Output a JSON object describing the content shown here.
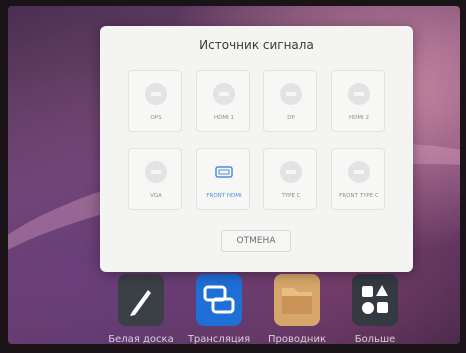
{
  "dialog": {
    "title": "Источник сигнала",
    "cancel_label": "ОТМЕНА",
    "sources": [
      {
        "label": "OPS",
        "icon": "ops-input-icon",
        "selected": false
      },
      {
        "label": "HDMI 1",
        "icon": "hdmi-input-icon",
        "selected": false
      },
      {
        "label": "DP",
        "icon": "displayport-input-icon",
        "selected": false
      },
      {
        "label": "HDMI 2",
        "icon": "hdmi-input-icon",
        "selected": false
      },
      {
        "label": "VGA",
        "icon": "vga-input-icon",
        "selected": false
      },
      {
        "label": "FRONT HDMI",
        "icon": "hdmi-input-icon",
        "selected": true
      },
      {
        "label": "TYPE C",
        "icon": "usb-c-input-icon",
        "selected": false
      },
      {
        "label": "FRONT TYPE C",
        "icon": "usb-c-input-icon",
        "selected": false
      }
    ],
    "accent_color": "#4a8fd6"
  },
  "dock": {
    "items": [
      {
        "label": "Белая доска",
        "icon": "pen-icon"
      },
      {
        "label": "Трансляция",
        "icon": "screen-cast-icon"
      },
      {
        "label": "Проводник",
        "icon": "folder-icon"
      },
      {
        "label": "Больше",
        "icon": "apps-grid-icon"
      }
    ]
  }
}
